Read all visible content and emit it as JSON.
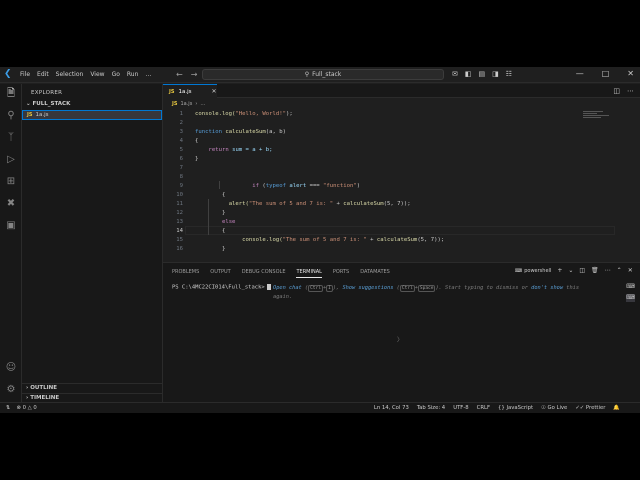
{
  "titlebar": {
    "menu": [
      "File",
      "Edit",
      "Selection",
      "View",
      "Go",
      "Run",
      "…"
    ],
    "search_text": "Full_stack"
  },
  "sidebar": {
    "title": "EXPLORER",
    "folder": "FULL_STACK",
    "file": "1a.js",
    "file_badge": "JS",
    "outline": "OUTLINE",
    "timeline": "TIMELINE"
  },
  "editor": {
    "tab_label": "1a.js",
    "tab_badge": "JS",
    "breadcrumb_file": "1a.js",
    "breadcrumb_more": "…",
    "current_line": 14,
    "line_numbers": [
      "1",
      "2",
      "3",
      "4",
      "5",
      "6",
      "7",
      "8",
      "9",
      "10",
      "11",
      "12",
      "13",
      "14",
      "15",
      "16"
    ],
    "code": {
      "l1_fn": "console.log(",
      "l1_str": "\"Hello, World!\"",
      "l1_end": ");",
      "l3_kw": "function",
      "l3_name": "calculateSum",
      "l3_params": "(a, b)",
      "l4": "{",
      "l5_kw": "return",
      "l5_rest": "sum = a + b;",
      "l6": "}",
      "l8_if": "if",
      "l8_typeof": "typeof",
      "l8_var": "alert",
      "l8_op": " === ",
      "l8_str": "\"function\"",
      "l8_end": ")",
      "l9": "{",
      "l10_fn": "alert(",
      "l10_str": "\"The sum of 5 and 7 is: \"",
      "l10_mid": " + ",
      "l10_fn2": "calculateSum",
      "l10_args": "(5, 7));",
      "l11": "}",
      "l12_kw": "else",
      "l13": "{",
      "l14_fn": "console.log(",
      "l14_str": "\"The sum of 5 and 7 is: \"",
      "l14_mid": " + ",
      "l14_fn2": "calculateSum",
      "l14_args": "(5, 7));",
      "l15": "}"
    }
  },
  "panel": {
    "tabs": [
      "PROBLEMS",
      "OUTPUT",
      "DEBUG CONSOLE",
      "TERMINAL",
      "PORTS",
      "DATAMATES"
    ],
    "active_tab": "TERMINAL",
    "shell": "powershell",
    "prompt": "PS C:\\4MC22CI014\\Full_stack>",
    "hint": {
      "open_chat": "Open chat",
      "k1": "Ctrl",
      "k2": "I",
      "show_suggestions": "Show suggestions",
      "k3": "Ctrl",
      "k4": "Space",
      "middle": ". Start typing to dismiss or",
      "dont_show": "don't show",
      "tail": "this",
      "again": "again."
    }
  },
  "statusbar": {
    "errors": "0",
    "warnings": "0",
    "position": "Ln 14, Col 73",
    "tab_size": "Tab Size: 4",
    "encoding": "UTF-8",
    "eol": "CRLF",
    "language": "JavaScript",
    "go_live": "Go Live",
    "prettier": "Prettier"
  },
  "colors": {
    "accent": "#0078d4",
    "keyword": "#569cd6",
    "function": "#dcdcaa",
    "string": "#ce9178",
    "js_badge": "#e8c840"
  }
}
